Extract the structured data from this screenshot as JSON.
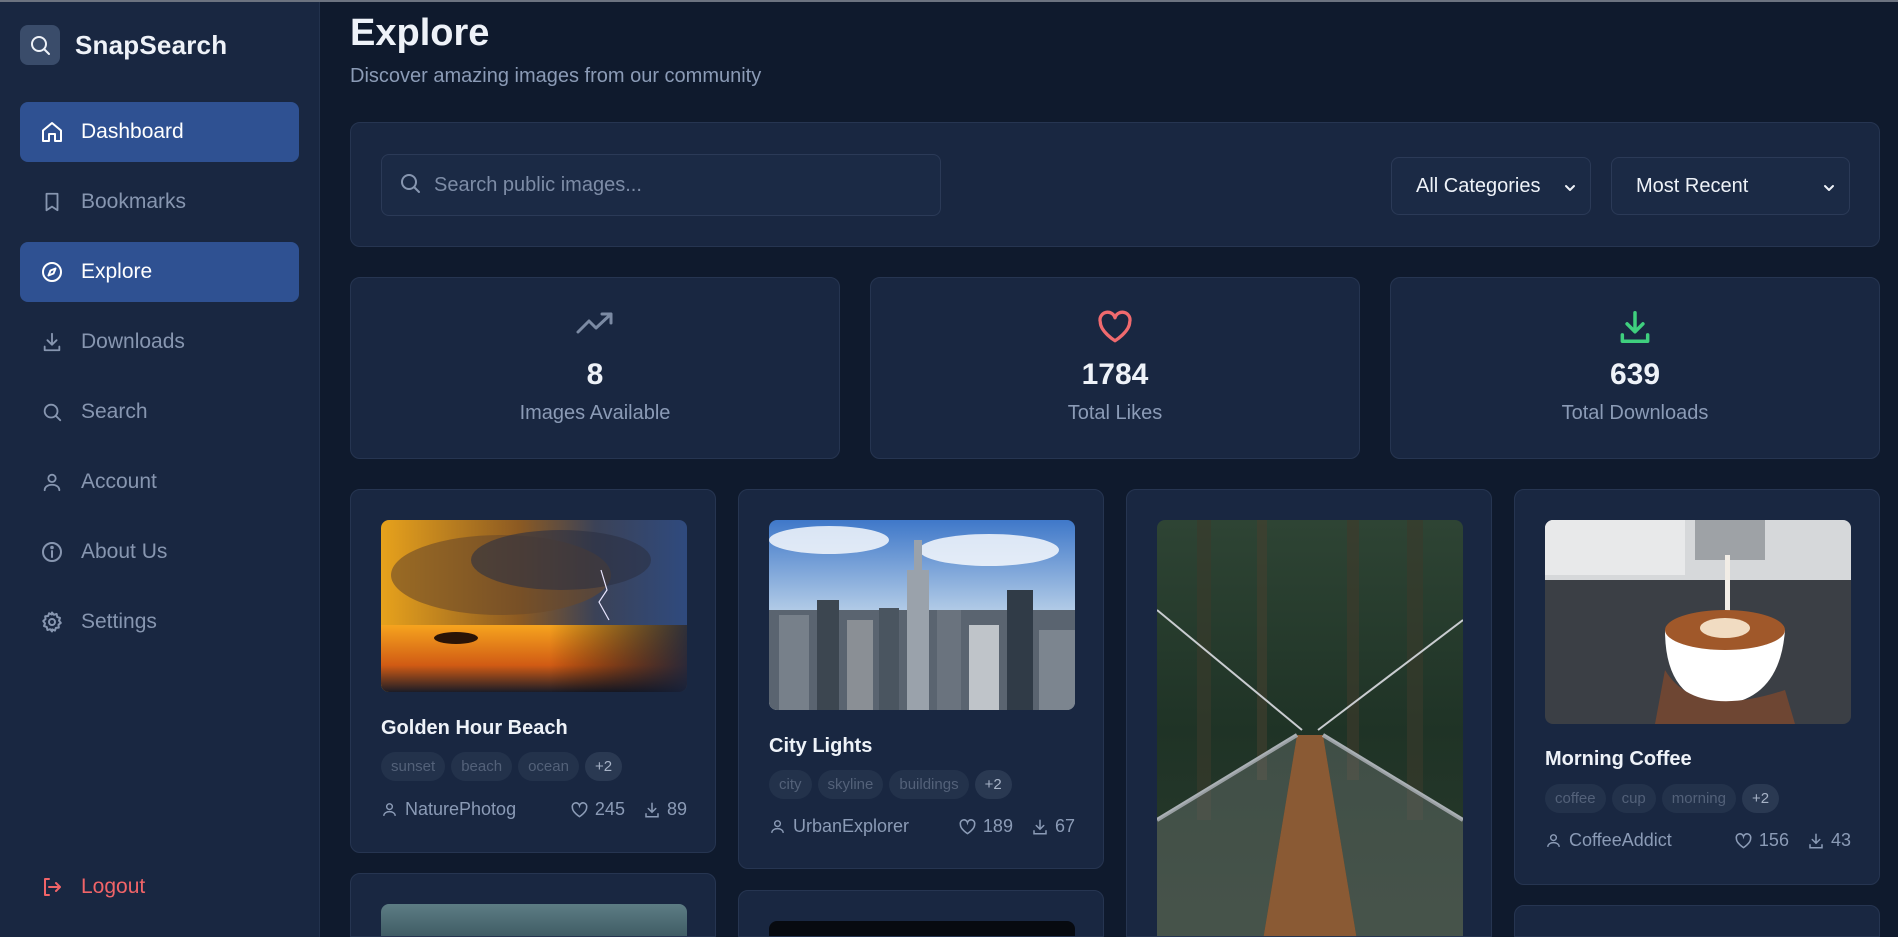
{
  "app": {
    "name": "SnapSearch"
  },
  "sidebar": {
    "items": [
      {
        "label": "Dashboard",
        "icon": "home-icon"
      },
      {
        "label": "Bookmarks",
        "icon": "bookmark-icon"
      },
      {
        "label": "Explore",
        "icon": "compass-icon"
      },
      {
        "label": "Downloads",
        "icon": "download-icon"
      },
      {
        "label": "Search",
        "icon": "search-icon"
      },
      {
        "label": "Account",
        "icon": "user-icon"
      },
      {
        "label": "About Us",
        "icon": "info-icon"
      },
      {
        "label": "Settings",
        "icon": "gear-icon"
      }
    ],
    "logout": {
      "label": "Logout",
      "icon": "logout-icon"
    }
  },
  "header": {
    "title": "Explore",
    "subtitle": "Discover amazing images from our community"
  },
  "search": {
    "placeholder": "Search public images...",
    "category": "All Categories",
    "sort": "Most Recent"
  },
  "stats": [
    {
      "value": "8",
      "label": "Images Available",
      "icon": "trending-up-icon",
      "color": "#7b8aa3"
    },
    {
      "value": "1784",
      "label": "Total Likes",
      "icon": "heart-icon",
      "color": "#f06a6e"
    },
    {
      "value": "639",
      "label": "Total Downloads",
      "icon": "download-icon",
      "color": "#3fcf7e"
    }
  ],
  "cards": [
    {
      "title": "Golden Hour Beach",
      "tags": [
        "sunset",
        "beach",
        "ocean",
        "+2"
      ],
      "author": "NaturePhotog",
      "likes": "245",
      "downloads": "89",
      "image": "stormy-sunset-sea"
    },
    {
      "title": "City Lights",
      "tags": [
        "city",
        "skyline",
        "buildings",
        "+2"
      ],
      "author": "UrbanExplorer",
      "likes": "189",
      "downloads": "67",
      "image": "city-skyline"
    },
    {
      "title": "",
      "tags": [],
      "author": "",
      "likes": "",
      "downloads": "",
      "image": "forest-suspension-bridge"
    },
    {
      "title": "Morning Coffee",
      "tags": [
        "coffee",
        "cup",
        "morning",
        "+2"
      ],
      "author": "CoffeeAddict",
      "likes": "156",
      "downloads": "43",
      "image": "latte-art"
    }
  ],
  "colors": {
    "background": "#0f1a2d",
    "panel": "#192741",
    "accent": "#2f5192",
    "logout": "#f16468"
  }
}
